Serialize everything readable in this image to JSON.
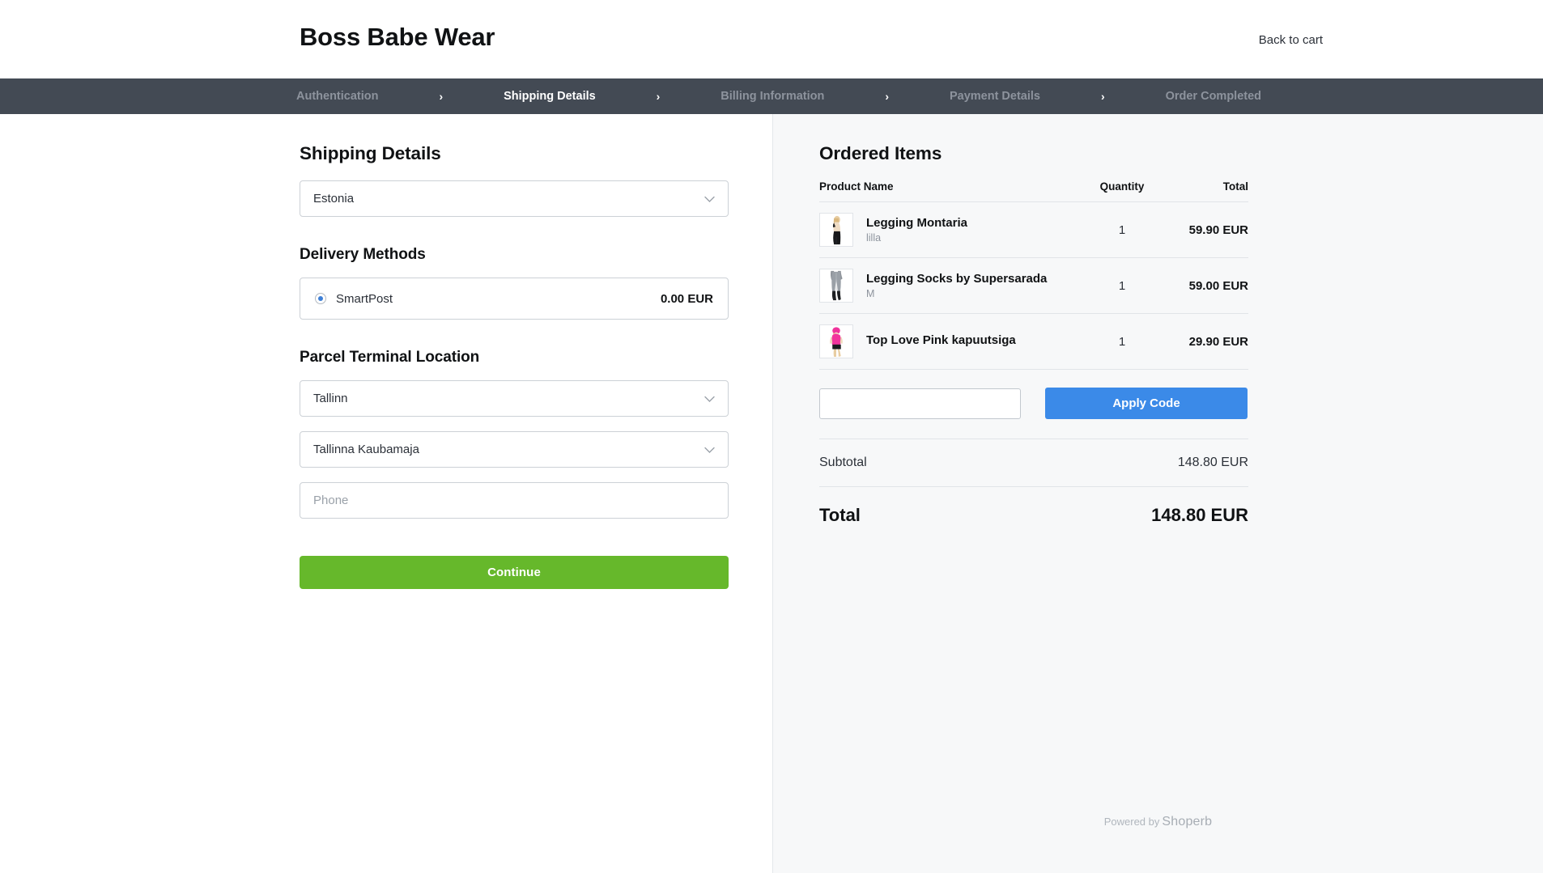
{
  "header": {
    "store_name": "Boss Babe Wear",
    "back_link": "Back to cart"
  },
  "steps": [
    {
      "label": "Authentication",
      "active": false
    },
    {
      "label": "Shipping Details",
      "active": true
    },
    {
      "label": "Billing Information",
      "active": false
    },
    {
      "label": "Payment Details",
      "active": false
    },
    {
      "label": "Order Completed",
      "active": false
    }
  ],
  "step_separator": "›",
  "shipping": {
    "title": "Shipping Details",
    "country_value": "Estonia",
    "delivery_title": "Delivery Methods",
    "delivery_method": {
      "name": "SmartPost",
      "price": "0.00 EUR",
      "selected": true
    },
    "terminal_title": "Parcel Terminal Location",
    "city_value": "Tallinn",
    "terminal_value": "Tallinna Kaubamaja",
    "phone_placeholder": "Phone",
    "phone_value": "",
    "continue_label": "Continue",
    "chevron_icon": "⌄"
  },
  "summary": {
    "title": "Ordered Items",
    "columns": {
      "name": "Product Name",
      "quantity": "Quantity",
      "total": "Total"
    },
    "items": [
      {
        "name": "Legging Montaria",
        "variant": "lilla",
        "quantity": "1",
        "total": "59.90 EUR",
        "thumb": "woman-black-leggings-photo"
      },
      {
        "name": "Legging Socks by Supersarada",
        "variant": "M",
        "quantity": "1",
        "total": "59.00 EUR",
        "thumb": "grey-legging-socks-photo"
      },
      {
        "name": "Top Love Pink kapuutsiga",
        "variant": "",
        "quantity": "1",
        "total": "29.90 EUR",
        "thumb": "pink-hooded-top-photo"
      }
    ],
    "coupon_value": "",
    "apply_label": "Apply Code",
    "subtotal_label": "Subtotal",
    "subtotal_value": "148.80 EUR",
    "total_label": "Total",
    "total_value": "148.80 EUR"
  },
  "footer": {
    "powered_by": "Powered by",
    "platform": "Shoperb"
  },
  "colors": {
    "nav_bar": "#434a54",
    "continue_button": "#66b82b",
    "apply_button": "#3b8ae8",
    "radio_accent": "#3d7fd6",
    "panel_background": "#f7f8f9"
  }
}
